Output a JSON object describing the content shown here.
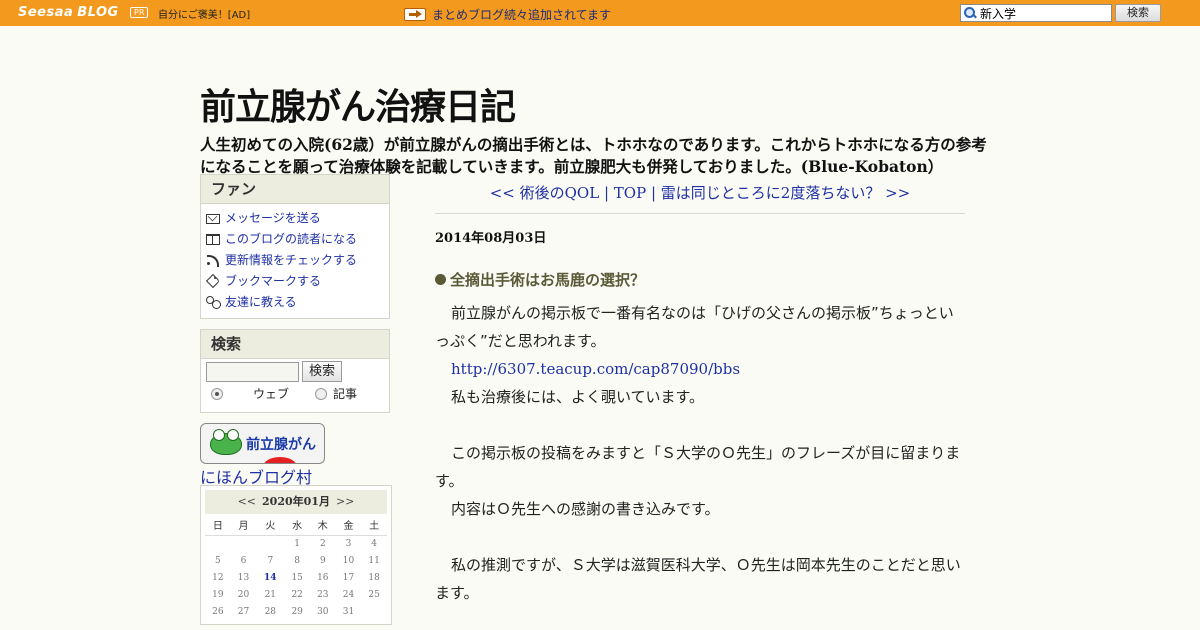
{
  "topbar": {
    "logo_brand": "Seesaa",
    "logo_blog": "BLOG",
    "pr_badge": "PR",
    "ad_text": "自分にご褒美！[AD]",
    "notice": "まとめブログ続々追加されてます",
    "search_value": "新入学",
    "search_button": "検索"
  },
  "header": {
    "title": "前立腺がん治療日記",
    "description": "人生初めての入院(62歳）が前立腺がんの摘出手術とは、トホホなのであります。これからトホホになる方の参考になることを願って治療体験を記載していきます。前立腺肥大も併発しておりました。(Blue-Kobaton）"
  },
  "sidebar": {
    "fan": {
      "heading": "ファン",
      "items": [
        {
          "label": "メッセージを送る",
          "icon": "envelope-icon"
        },
        {
          "label": "このブログの読者になる",
          "icon": "book-icon"
        },
        {
          "label": "更新情報をチェックする",
          "icon": "feed-icon"
        },
        {
          "label": "ブックマークする",
          "icon": "tag-icon"
        },
        {
          "label": "友達に教える",
          "icon": "friends-icon"
        }
      ]
    },
    "search": {
      "heading": "検索",
      "input_value": "",
      "button": "検索",
      "option_web": "ウェブ",
      "option_article": "記事",
      "selected": "ウェブ"
    },
    "banner": {
      "text": "前立腺がん",
      "link": "にほんブログ村"
    },
    "calendar": {
      "prev": "<<",
      "month": "2020年01月",
      "next": ">>",
      "weekdays": [
        "日",
        "月",
        "火",
        "水",
        "木",
        "金",
        "土"
      ],
      "weeks": [
        [
          "",
          "",
          "",
          "1",
          "2",
          "3",
          "4"
        ],
        [
          "5",
          "6",
          "7",
          "8",
          "9",
          "10",
          "11"
        ],
        [
          "12",
          "13",
          "14",
          "15",
          "16",
          "17",
          "18"
        ],
        [
          "19",
          "20",
          "21",
          "22",
          "23",
          "24",
          "25"
        ],
        [
          "26",
          "27",
          "28",
          "29",
          "30",
          "31",
          ""
        ]
      ],
      "highlighted_day": "14"
    }
  },
  "main": {
    "nav": {
      "prev": "<< 術後のQOL",
      "sep1": " | ",
      "top": "TOP",
      "sep2": " | ",
      "next": "雷は同じところに2度落ちない？ >>"
    },
    "date": "2014年08月03日",
    "title": "全摘出手術はお馬鹿の選択？",
    "body": {
      "p1": "前立腺がんの掲示板で一番有名なのは「ひげの父さんの掲示板”ちょっといっぷく”だと思われます。",
      "link": "http://6307.teacup.com/cap87090/bbs",
      "p2": "私も治療後には、よく覗いています。",
      "p3": "この掲示板の投稿をみますと「Ｓ大学のＯ先生」のフレーズが目に留まります。",
      "p4": "内容はＯ先生への感謝の書き込みです。",
      "p5": "私の推測ですが、Ｓ大学は滋賀医科大学、Ｏ先生は岡本先生のことだと思います。"
    }
  }
}
